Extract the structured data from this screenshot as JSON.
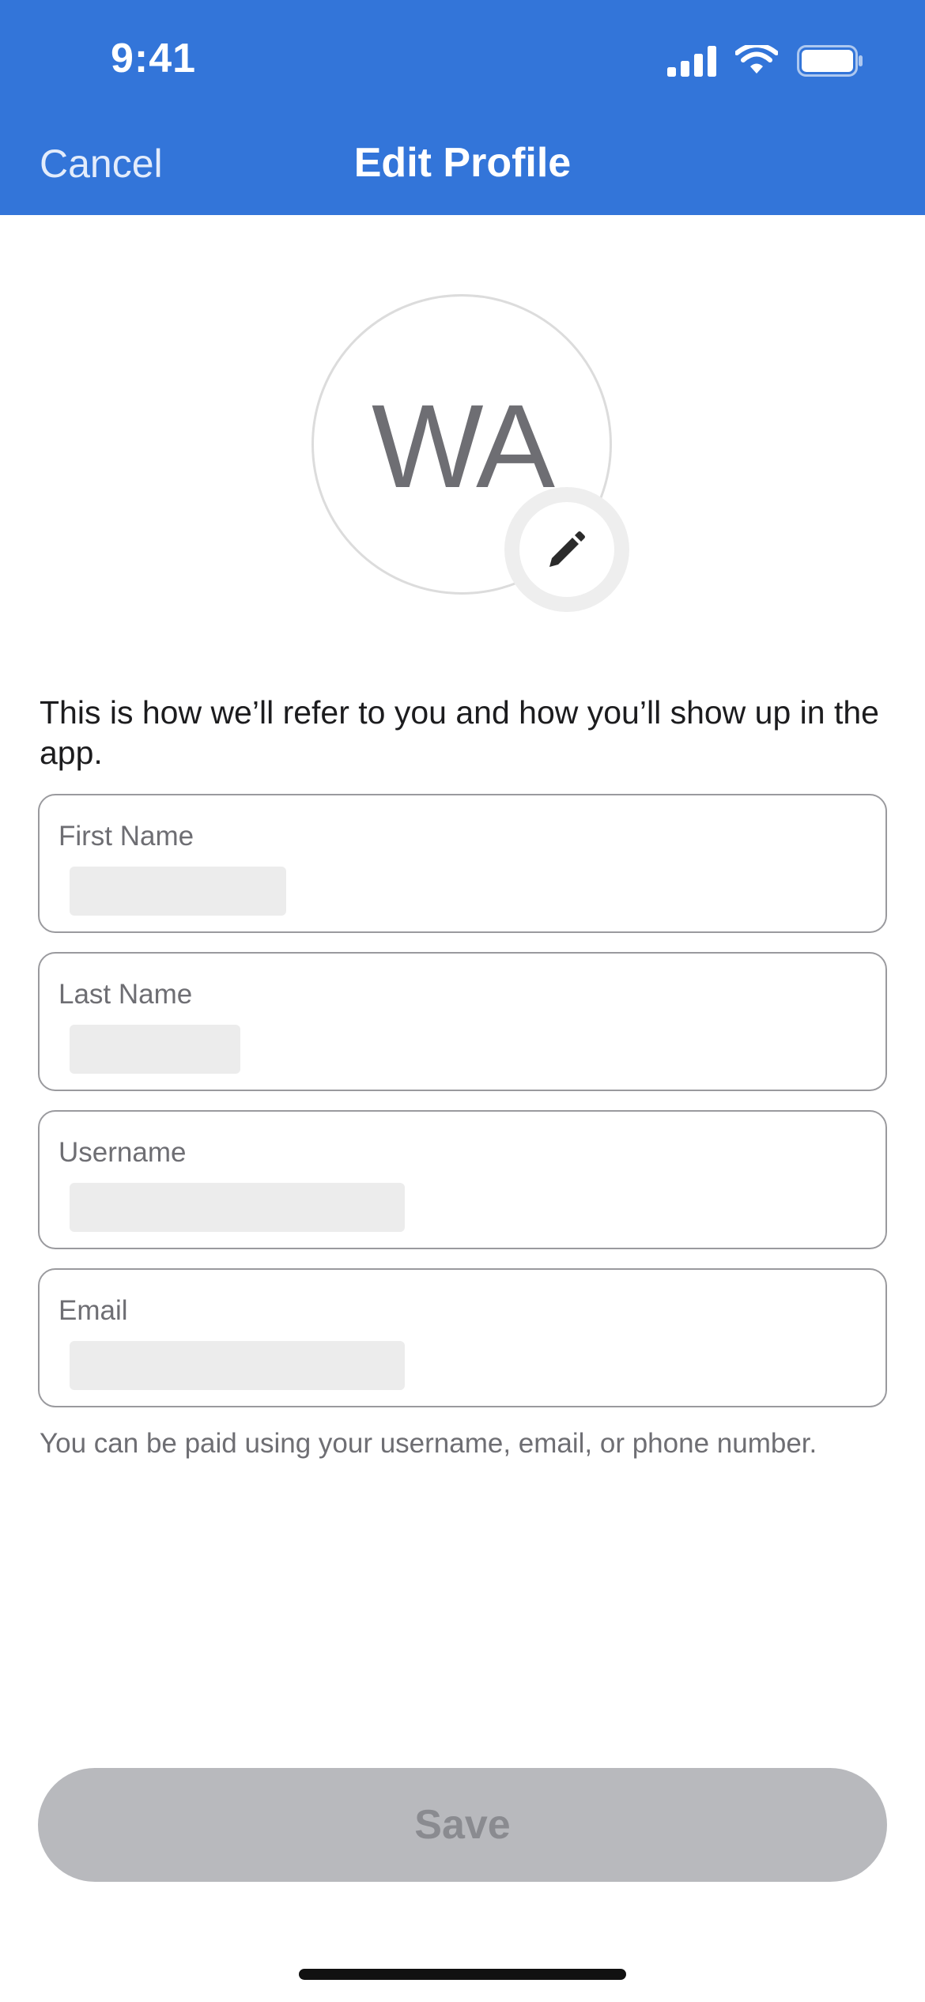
{
  "status_bar": {
    "time": "9:41",
    "icons": [
      "cellular-signal-icon",
      "wifi-icon",
      "battery-icon"
    ]
  },
  "nav": {
    "cancel_label": "Cancel",
    "title": "Edit Profile"
  },
  "avatar": {
    "initials": "WA",
    "edit_icon": "pencil-icon"
  },
  "intro_text": "This is how we’ll refer to you and how you’ll show up in the app.",
  "fields": {
    "first_name": {
      "label": "First Name",
      "value": ""
    },
    "last_name": {
      "label": "Last Name",
      "value": ""
    },
    "username": {
      "label": "Username",
      "value": ""
    },
    "email": {
      "label": "Email",
      "value": ""
    }
  },
  "hint_text": "You can be paid using your username, email, or phone number.",
  "save_label": "Save",
  "colors": {
    "header_bg": "#3375d9",
    "save_disabled_bg": "#b8b9bd",
    "save_disabled_text": "#8a8b90",
    "label_text": "#6e6e73"
  }
}
